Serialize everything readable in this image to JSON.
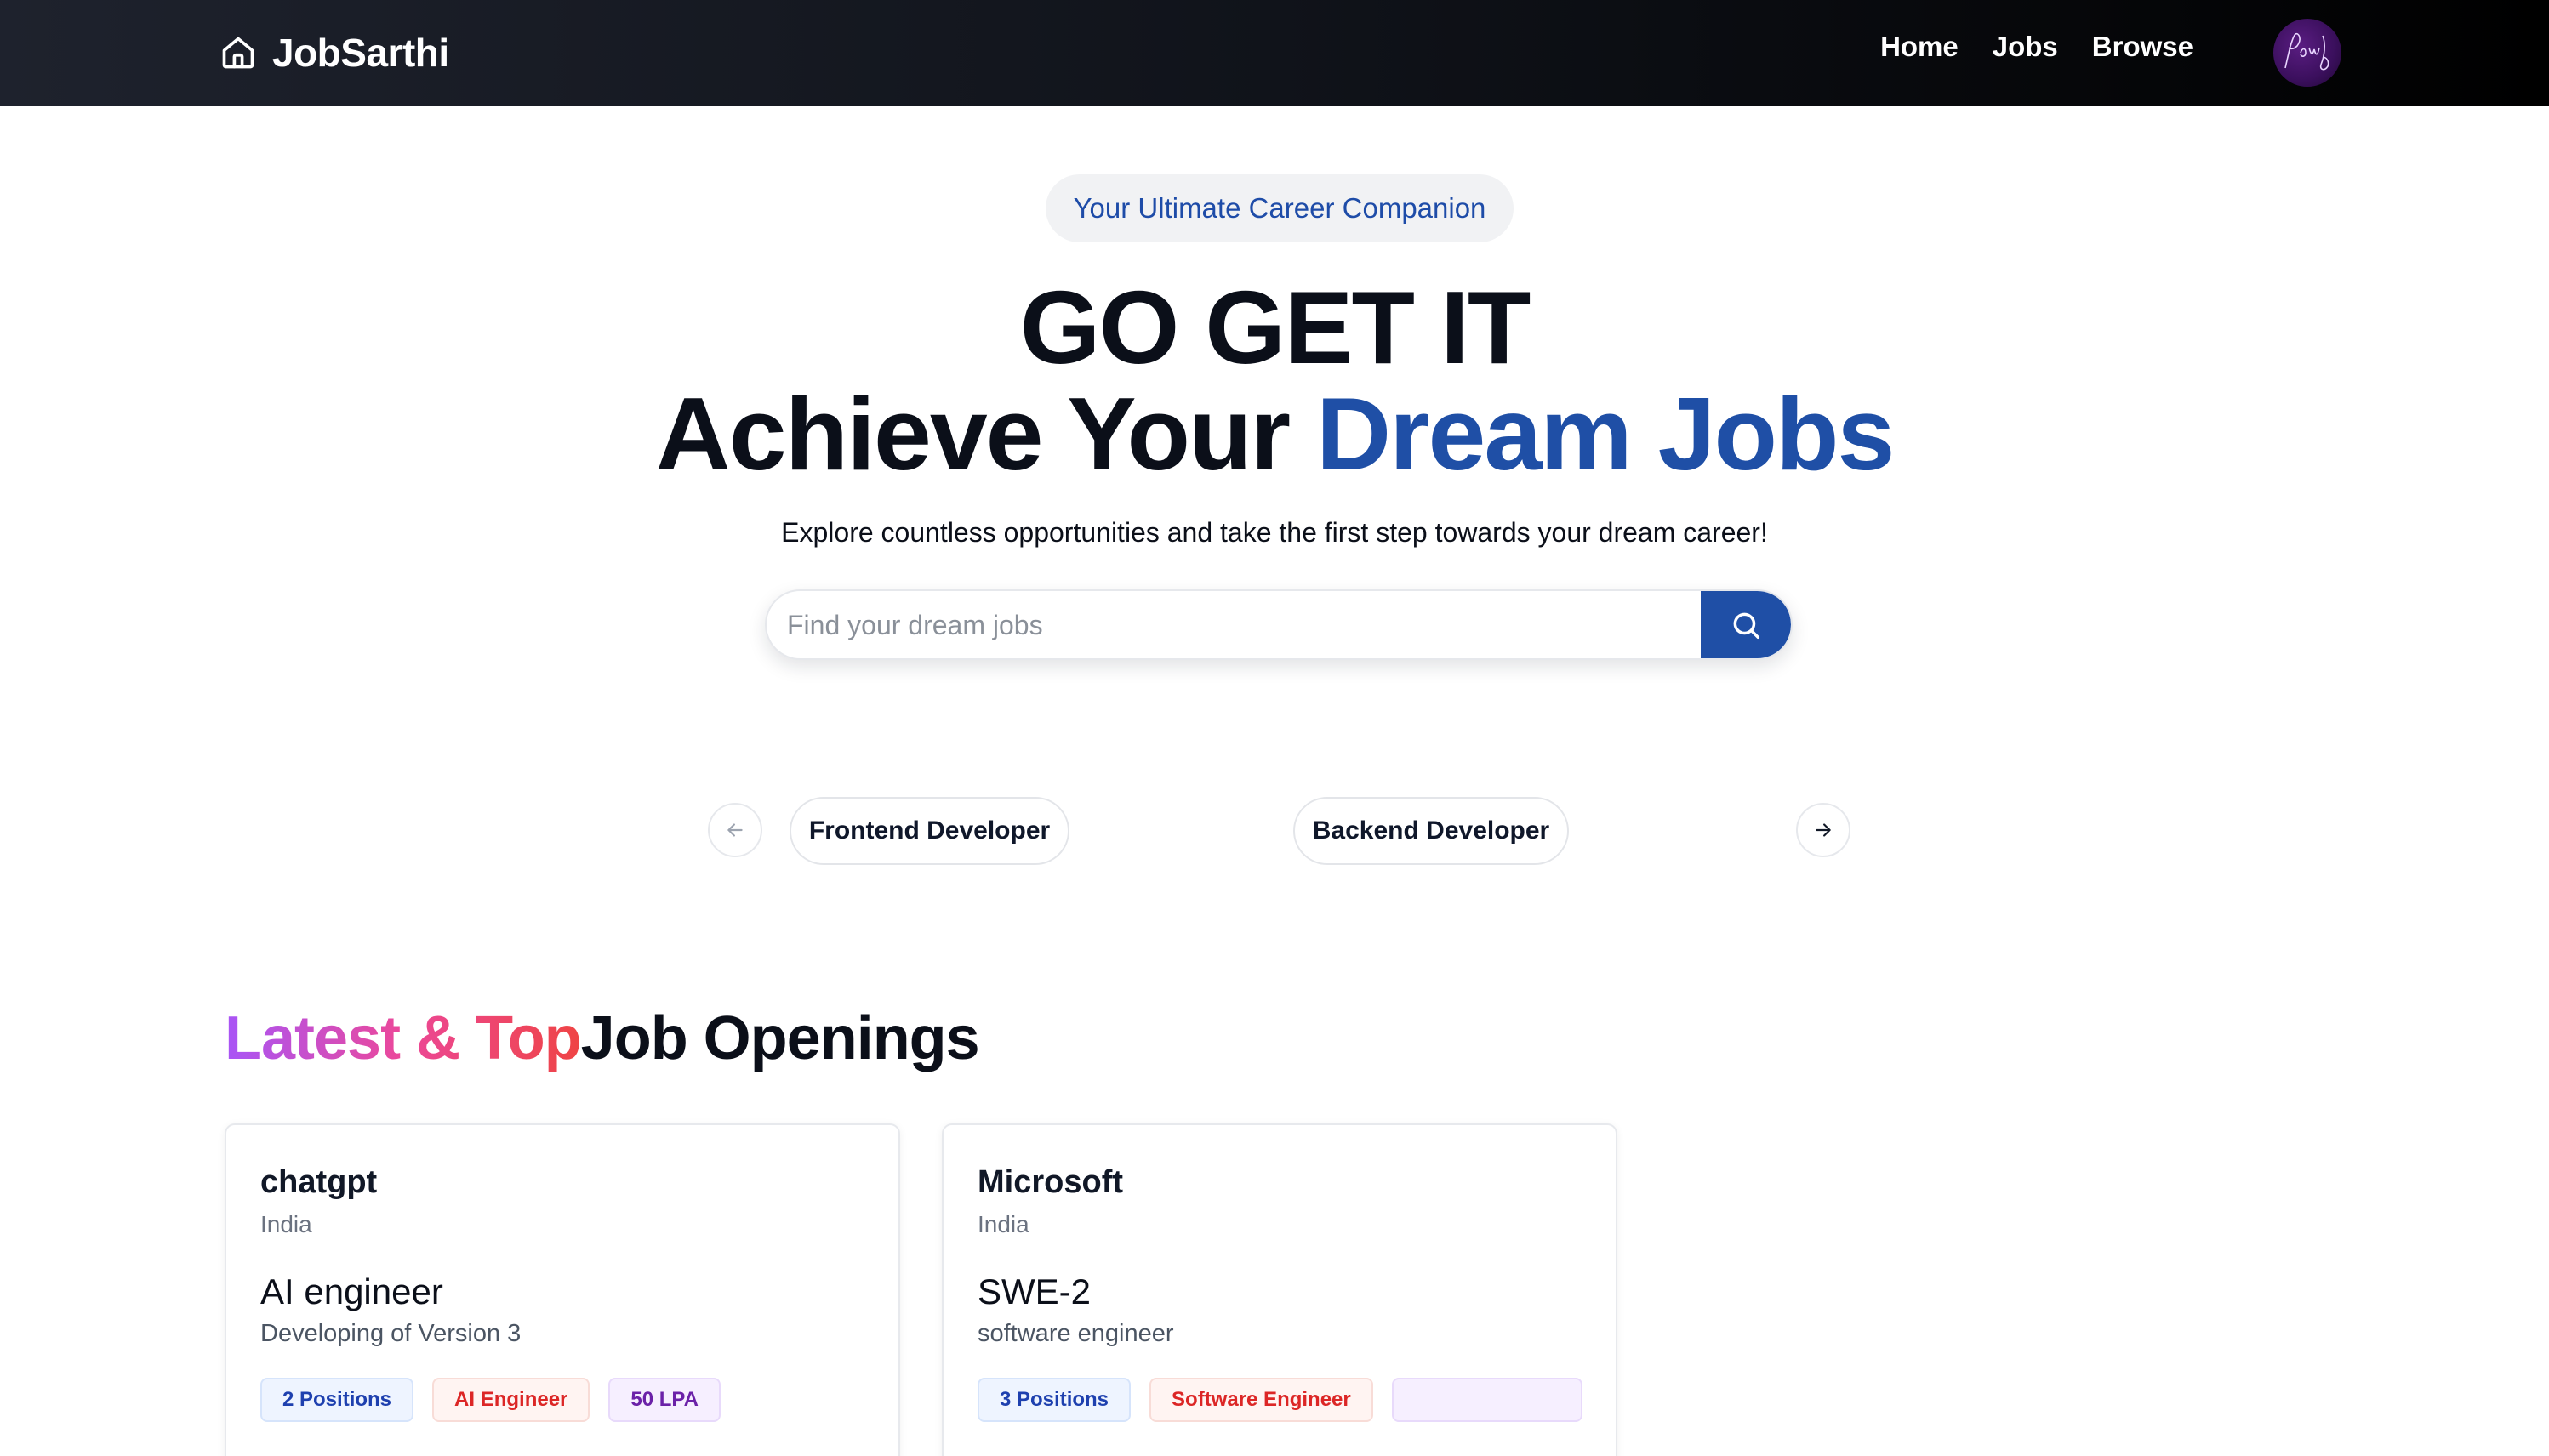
{
  "navbar": {
    "brand": "JobSarthi",
    "links": [
      "Home",
      "Jobs",
      "Browse"
    ]
  },
  "hero": {
    "badge": "Your Ultimate Career Companion",
    "line1": "GO GET IT",
    "line2_prefix": "Achieve Your ",
    "line2_highlight": "Dream Jobs",
    "subtitle": "Explore countless opportunities and take the first step towards your dream career!"
  },
  "search": {
    "placeholder": "Find your dream jobs",
    "value": ""
  },
  "carousel": {
    "categories": [
      "Frontend Developer",
      "Backend Developer"
    ]
  },
  "section": {
    "title_accent": "Latest & Top",
    "title_rest": "Job Openings"
  },
  "jobs": [
    {
      "company": "chatgpt",
      "location": "India",
      "title": "AI engineer",
      "description": "Developing of Version 3",
      "positions": "2 Positions",
      "role": "AI Engineer",
      "salary": "50 LPA"
    },
    {
      "company": "Microsoft",
      "location": "India",
      "title": "SWE-2",
      "description": "software engineer",
      "positions": "3 Positions",
      "role": "Software Engineer",
      "salary": ""
    }
  ],
  "colors": {
    "primary": "#1f4fa6",
    "navbar_dark": "#10131a",
    "accent_gradient_start": "#a855f7",
    "accent_gradient_end": "#ef4444"
  }
}
